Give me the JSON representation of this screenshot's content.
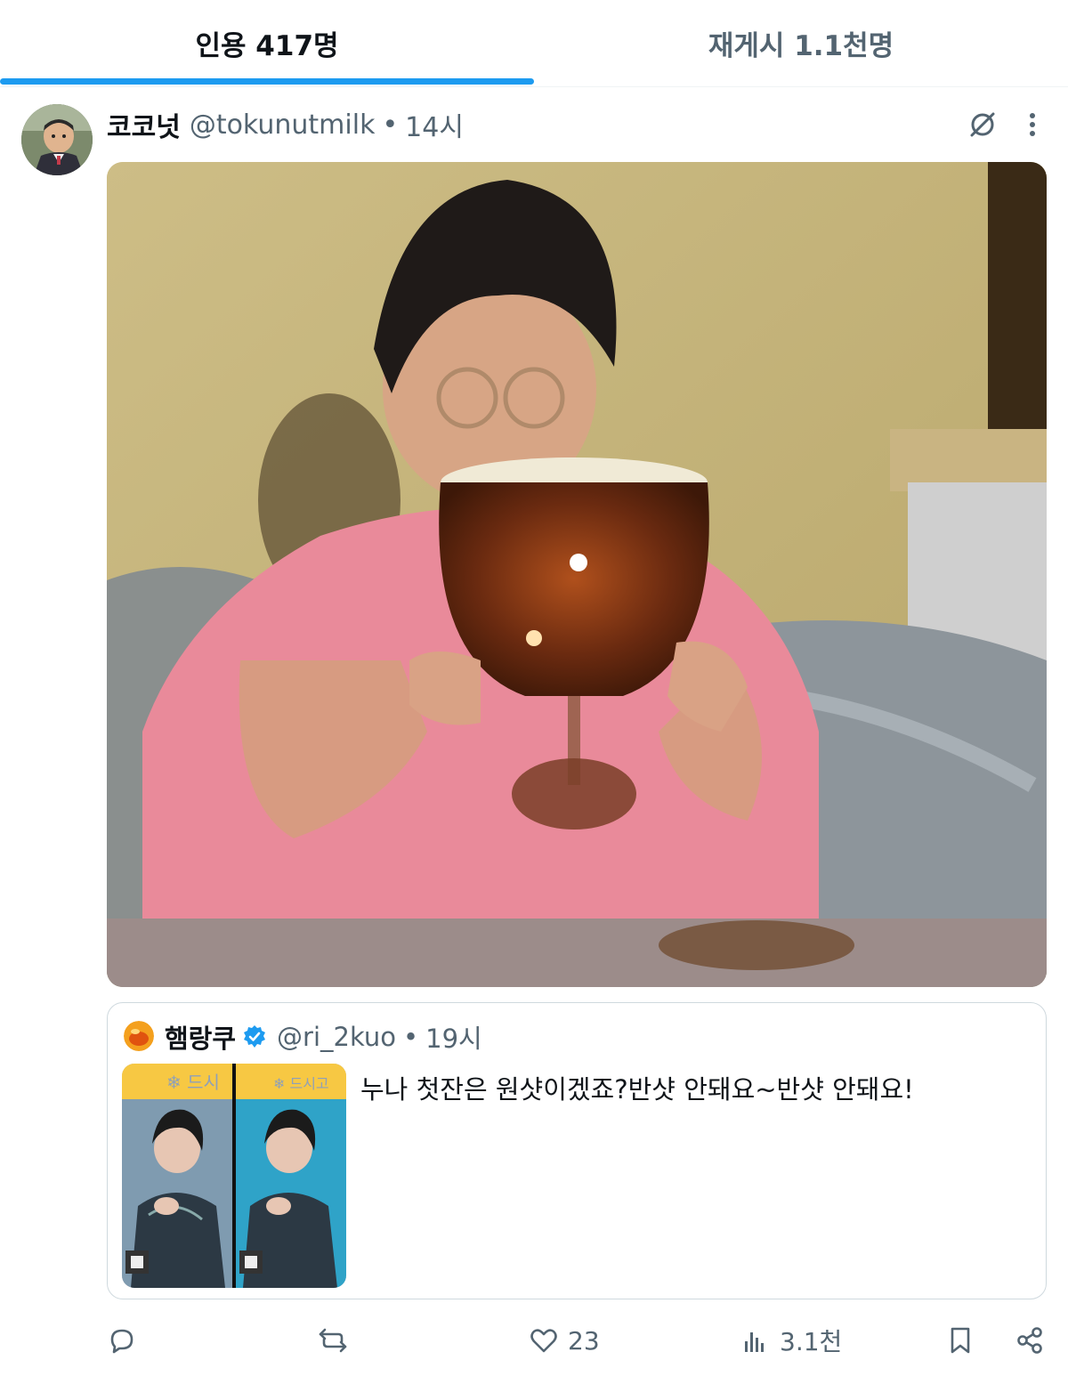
{
  "tabs": [
    {
      "label": "인용 417명",
      "active": true
    },
    {
      "label": "재게시 1.1천명",
      "active": false
    }
  ],
  "colors": {
    "accent": "#1d9bf0",
    "secondary_text": "#536471",
    "verified": "#1d9bf0"
  },
  "tweet": {
    "name": "코코넛",
    "handle": "@tokunutmilk",
    "separator": "•",
    "time": "14시",
    "quoted": {
      "name": "햄랑쿠",
      "verified": true,
      "handle": "@ri_2kuo",
      "separator": "•",
      "time": "19시",
      "text": "누나 첫잔은 원샷이겠죠?반샷 안돼요~반샷 안돼요!",
      "thumbnail_signs": [
        "❄ 드시",
        "❄ 드시고"
      ]
    },
    "actions": {
      "reply": {
        "icon": "reply-icon",
        "count": ""
      },
      "repost": {
        "icon": "repost-icon",
        "count": ""
      },
      "like": {
        "icon": "heart-icon",
        "count": "23"
      },
      "views": {
        "icon": "views-icon",
        "count": "3.1천"
      },
      "bookmark": {
        "icon": "bookmark-icon"
      },
      "share": {
        "icon": "share-icon"
      }
    }
  }
}
